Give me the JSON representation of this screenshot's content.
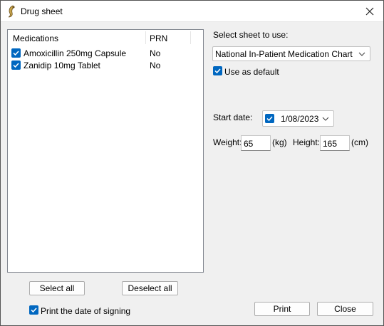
{
  "window": {
    "title": "Drug sheet"
  },
  "medications": {
    "headers": {
      "name": "Medications",
      "prn": "PRN"
    },
    "rows": [
      {
        "name": "Amoxicillin 250mg Capsule",
        "prn": "No",
        "checked": true
      },
      {
        "name": "Zanidip 10mg Tablet",
        "prn": "No",
        "checked": true
      }
    ]
  },
  "sheet": {
    "label": "Select sheet to use:",
    "selected": "National In-Patient Medication Chart",
    "use_default_label": "Use as default",
    "use_default_checked": true
  },
  "start_date": {
    "label": "Start date:",
    "value": "1/08/2023",
    "checked": true
  },
  "weight": {
    "label": "Weight:",
    "value": "65",
    "unit": "(kg)"
  },
  "height": {
    "label": "Height:",
    "value": "165",
    "unit": "(cm)"
  },
  "buttons": {
    "select_all": "Select all",
    "deselect_all": "Deselect all",
    "print": "Print",
    "close": "Close"
  },
  "print_date": {
    "label": "Print the date of signing",
    "checked": true
  },
  "colors": {
    "accent": "#0067c0",
    "dialog_bg": "#f0f0f0"
  }
}
